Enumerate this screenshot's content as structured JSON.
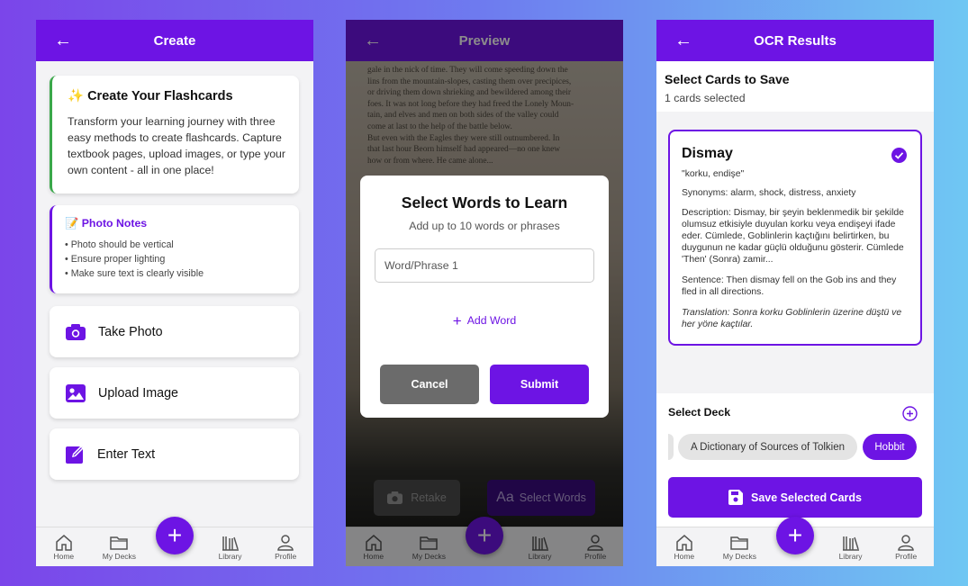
{
  "colors": {
    "primary": "#6d14e4",
    "accent_green": "#3aa84a"
  },
  "nav": {
    "home": "Home",
    "decks": "My Decks",
    "library": "Library",
    "profile": "Profile",
    "fab": "+"
  },
  "create": {
    "title": "Create",
    "back": "←",
    "intro_title": "✨ Create Your Flashcards",
    "intro_text": "Transform your learning journey with three easy methods to create flashcards. Capture textbook pages, upload images, or type your own content - all in one place!",
    "notes_title": "📝 Photo Notes",
    "notes": [
      "• Photo should be vertical",
      "• Ensure proper lighting",
      "• Make sure text is clearly visible"
    ],
    "actions": [
      {
        "label": "Take Photo",
        "icon": "camera-icon"
      },
      {
        "label": "Upload Image",
        "icon": "image-icon"
      },
      {
        "label": "Enter Text",
        "icon": "edit-icon"
      }
    ]
  },
  "preview": {
    "title": "Preview",
    "back": "←",
    "book_text": [
      "gale in the nick of time. They will come speeding down the",
      "lins from the mountain-slopes, casting them over precipices,",
      "or driving them down shrieking and bewildered among their",
      "foes. It was not long before they had freed the Lonely Moun-",
      "tain, and elves and men on both sides of the valley could",
      "come at last to the help of the battle below.",
      "But even with the Eagles they were still outnumbered. In",
      "that last hour Beorn himself had appeared—no one knew",
      "how or from where. He came alone..."
    ],
    "dialog_title": "Select Words to Learn",
    "dialog_sub": "Add up to 10 words or phrases",
    "input_placeholder": "Word/Phrase 1",
    "add_word": "Add Word",
    "cancel": "Cancel",
    "submit": "Submit",
    "retake": "Retake",
    "select_words": "Select Words"
  },
  "ocr": {
    "title": "OCR Results",
    "back": "←",
    "select_title": "Select Cards to Save",
    "selected_count": "1 cards selected",
    "card": {
      "word": "Dismay",
      "translation": "\"korku, endişe\"",
      "synonyms": "Synonyms: alarm, shock, distress, anxiety",
      "description": "Description: Dismay, bir şeyin beklenmedik bir şekilde olumsuz etkisiyle duyulan korku veya endişeyi ifade eder. Cümlede, Goblinlerin kaçtığını belirtirken, bu duygunun ne kadar güçlü olduğunu gösterir. Cümlede 'Then' (Sonra) zamir...",
      "sentence": "Sentence: Then dismay fell on the Gob ins and they fled in all directions.",
      "sentence_translation": "Translation: Sonra korku Goblinlerin üzerine düştü ve her yöne kaçtılar."
    },
    "deck_title": "Select Deck",
    "decks": [
      "A Dictionary of Sources of Tolkien",
      "Hobbit"
    ],
    "save": "Save Selected Cards"
  }
}
